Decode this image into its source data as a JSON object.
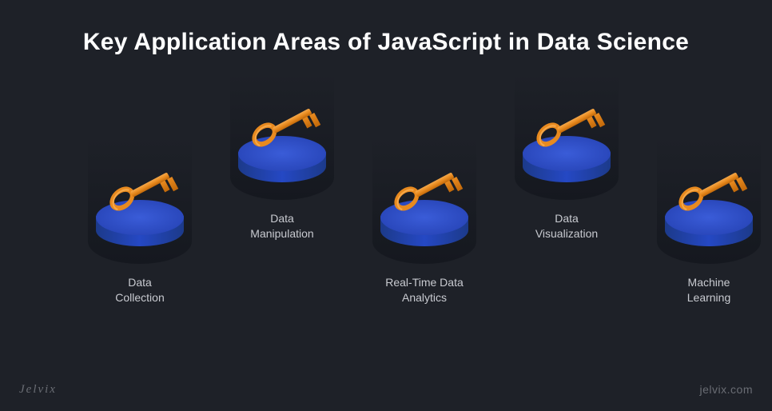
{
  "title": "Key Application Areas of JavaScript in Data Science",
  "cards": [
    {
      "label": "Data\nCollection"
    },
    {
      "label": "Data\nManipulation"
    },
    {
      "label": "Real-Time Data\nAnalytics"
    },
    {
      "label": "Data\nVisualization"
    },
    {
      "label": "Machine\nLearning"
    }
  ],
  "footer": {
    "brand": "Jelvix",
    "url": "jelvix.com"
  }
}
